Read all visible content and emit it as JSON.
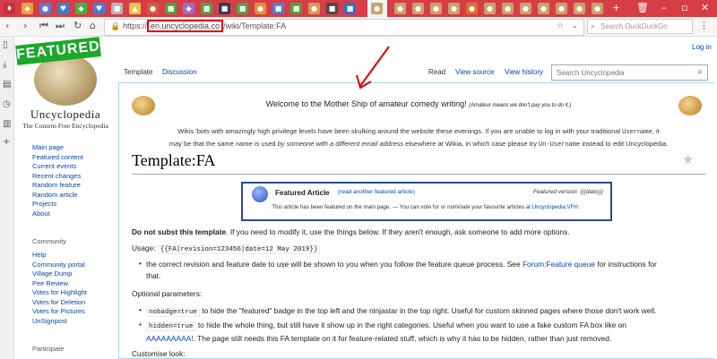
{
  "browser": {
    "url_prefix": "https://",
    "url_host": "en.uncyclopedia.co",
    "url_path": "/wiki/Template:FA",
    "search_placeholder": "Search DuckDuckGo",
    "accent": "#d73d47"
  },
  "wiki": {
    "login": "Log in",
    "logo_badge": "FEATURED",
    "logo_title": "Uncyclopedia",
    "logo_sub": "The Content-Free Encyclopedia",
    "tabs": {
      "template": "Template",
      "discussion": "Discussion",
      "read": "Read",
      "view_source": "View source",
      "view_history": "View history"
    },
    "search_placeholder": "Search Uncyclopedia",
    "nav": [
      "Main page",
      "Featured content",
      "Current events",
      "Recent changes",
      "Random feature",
      "Random article",
      "Projects",
      "About"
    ],
    "community_heading": "Community",
    "community": [
      "Help",
      "Community portal",
      "Village Dump",
      "Pee Review",
      "Votes for Highlight",
      "Votes for Deletion",
      "Votes for Pictures",
      "UnSignpost"
    ],
    "participate_heading": "Participate",
    "notice": {
      "main": "Welcome to the Mother Ship of amateur comedy writing!",
      "small": "(Amateur means we don't pay you to do it.)",
      "line1_a": "Wikis 'bots with amazingly high privilege levels have been skulking around the website these evenings. If you are unable to log in with your traditional ",
      "line1_code": "Username",
      "line1_b": ", it",
      "line2_a": "may be that the same name is used ",
      "line2_em": "by someone with a different email address",
      "line2_b": " elsewhere at Wikia, in which case please try ",
      "line2_code": "Un-Username",
      "line2_c": " instead to edit Uncyclopedia."
    },
    "page_title": "Template:FA",
    "fa_box": {
      "title": "Featured Article",
      "link": "(read another featured article)",
      "version": "Featured version: {{{date}}}",
      "desc_a": "This article has been featured on the main page. — You can vote for or nominate your favourite articles at ",
      "desc_link": "Uncyclopedia:VFH",
      "desc_b": "."
    },
    "body": {
      "p1_bold": "Do not subst this template",
      "p1_rest": ". If you need to modify it, use the things below. If they aren't enough, ask someone to add more options.",
      "usage_label": "Usage:",
      "usage_code": "{{FA|revision=123456|date=12 May 2019}}",
      "bullet1_a": "the correct revision and feature date to use will be shown to you when you follow the feature queue process. See ",
      "bullet1_link": "Forum:Feature queue",
      "bullet1_b": " for instructions for",
      "bullet1_c": "that.",
      "optional": "Optional parameters:",
      "b2_code": "nobadge=true",
      "b2_text": " to hide the \"featured\" badge in the top left and the ninjastar in the top right. Useful for custom skinned pages where those don't work well.",
      "b3_code": "hidden=true",
      "b3_text": " to hide the whole thing, but still have it show up in the right categories. Useful when you want to use a fake custom FA box like on",
      "b3_link": "AAAAAAAAA!",
      "b3_text2": ". The page still needs this FA template on it for feature-related stuff, which is why it has to be hidden, rather than just removed.",
      "customise": "Customise look:"
    }
  }
}
